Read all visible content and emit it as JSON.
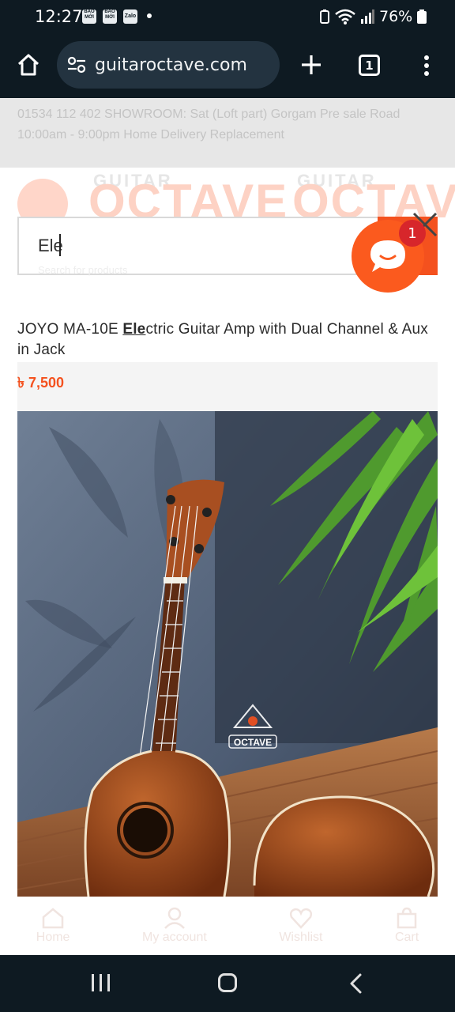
{
  "status_bar": {
    "time": "12:27",
    "notifications": [
      "BÁO MỚI",
      "BÁO MỚI",
      "Zalo"
    ],
    "battery": "76%"
  },
  "browser": {
    "url": "guitaroctave.com",
    "tab_count": "1"
  },
  "page": {
    "topbar_text": "01534 112 402   SHOWROOM: Sat (Loft part) Gorgam Pre sale Road   10:00am - 9:00pm   Home Delivery   Replacement",
    "logo_text": "OCTAVE",
    "logo_small": "GUITAR",
    "search": {
      "value": "Ele",
      "placeholder": "Search for products"
    },
    "result": {
      "title_before": "JOYO MA-10E ",
      "title_match": "Ele",
      "title_after": "ctric Guitar Amp with Dual Channel & Aux in Jack",
      "price": "৳ 7,500"
    },
    "product_image_watermark": "OCTAVE",
    "bottom_nav": [
      {
        "label": "Home",
        "icon": "home-icon"
      },
      {
        "label": "My account",
        "icon": "user-icon"
      },
      {
        "label": "Wishlist",
        "icon": "heart-icon"
      },
      {
        "label": "Cart",
        "icon": "cart-icon"
      }
    ]
  },
  "chat": {
    "badge_count": "1"
  },
  "colors": {
    "accent": "#f4511e",
    "chat": "#fb5a1e",
    "badge": "#d7262b",
    "system_bar": "#0e1a22"
  }
}
